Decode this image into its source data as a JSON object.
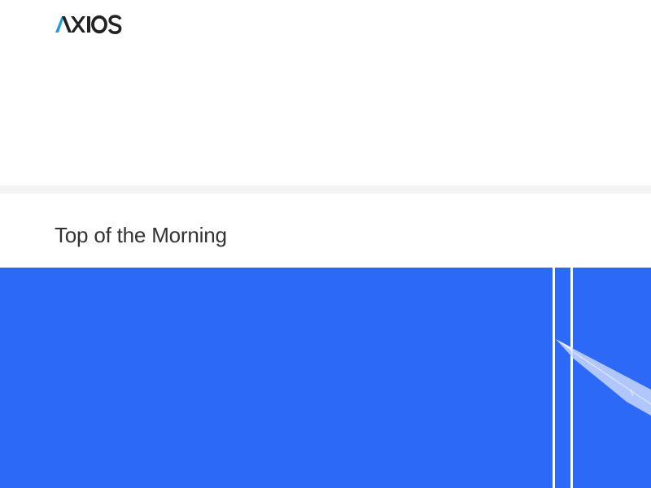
{
  "site": {
    "logo_text": "AXIOS",
    "logo_icon": "axios-logo-icon"
  },
  "newsletter": {
    "section_title": "Top of the Morning"
  },
  "hero_image": {
    "description_icon": "airplane-contrail-illustration-icon",
    "colors": {
      "background": "#2d69f7",
      "lines": "#ffffff",
      "contrail": "#c9d8fb"
    }
  },
  "colors": {
    "brand_dark": "#222222",
    "brand_accent": "#1b9ce5",
    "divider": "#f3f3f3",
    "title_text": "#333333"
  }
}
